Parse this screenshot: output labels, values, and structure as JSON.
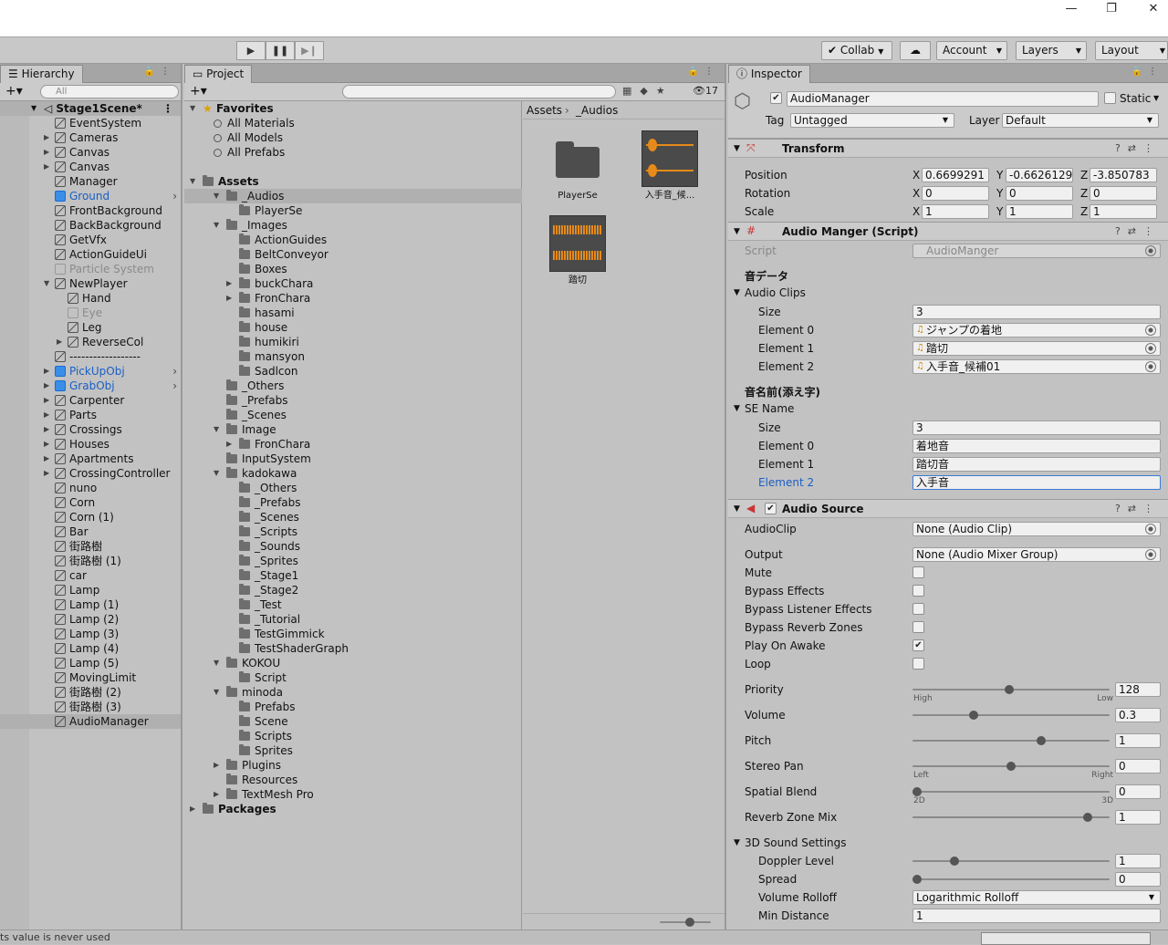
{
  "window_controls": [
    "—",
    "❐",
    "✕"
  ],
  "toolbar": {
    "collab": "Collab",
    "account": "Account",
    "layers": "Layers",
    "layout": "Layout",
    "play": "▶",
    "pause": "❚❚",
    "step": "▶❙"
  },
  "hierarchy": {
    "tab": "Hierarchy",
    "search_placeholder": "All",
    "scene": "Stage1Scene*",
    "items": [
      {
        "label": "EventSystem"
      },
      {
        "label": "Cameras"
      },
      {
        "label": "Canvas"
      },
      {
        "label": "Canvas"
      },
      {
        "label": "Manager"
      },
      {
        "label": "Ground"
      },
      {
        "label": "FrontBackground"
      },
      {
        "label": "BackBackground"
      },
      {
        "label": "GetVfx"
      },
      {
        "label": "ActionGuideUi"
      },
      {
        "label": "Particle System"
      },
      {
        "label": "NewPlayer"
      },
      {
        "label": "Hand"
      },
      {
        "label": "Eye"
      },
      {
        "label": "Leg"
      },
      {
        "label": "ReverseCol"
      },
      {
        "label": "------------------"
      },
      {
        "label": "PickUpObj"
      },
      {
        "label": "GrabObj"
      },
      {
        "label": "Carpenter"
      },
      {
        "label": "Parts"
      },
      {
        "label": "Crossings"
      },
      {
        "label": "Houses"
      },
      {
        "label": "Apartments"
      },
      {
        "label": "CrossingController"
      },
      {
        "label": "nuno"
      },
      {
        "label": "Corn"
      },
      {
        "label": "Corn (1)"
      },
      {
        "label": "Bar"
      },
      {
        "label": "街路樹"
      },
      {
        "label": "街路樹 (1)"
      },
      {
        "label": "car"
      },
      {
        "label": "Lamp"
      },
      {
        "label": "Lamp (1)"
      },
      {
        "label": "Lamp (2)"
      },
      {
        "label": "Lamp (3)"
      },
      {
        "label": "Lamp (4)"
      },
      {
        "label": "Lamp (5)"
      },
      {
        "label": "MovingLimit"
      },
      {
        "label": "街路樹 (2)"
      },
      {
        "label": "街路樹 (3)"
      },
      {
        "label": "AudioManager"
      }
    ]
  },
  "project": {
    "tab": "Project",
    "hidden_count": "17",
    "favorites": "Favorites",
    "fav_items": [
      "All Materials",
      "All Models",
      "All Prefabs"
    ],
    "tree": [
      "Assets",
      "_Audios",
      "PlayerSe",
      "_Images",
      "ActionGuides",
      "BeltConveyor",
      "Boxes",
      "buckChara",
      "FronChara",
      "hasami",
      "house",
      "humikiri",
      "mansyon",
      "Sadlcon",
      "_Others",
      "_Prefabs",
      "_Scenes",
      "Image",
      "FronChara",
      "InputSystem",
      "kadokawa",
      "_Others",
      "_Prefabs",
      "_Scenes",
      "_Scripts",
      "_Sounds",
      "_Sprites",
      "_Stage1",
      "_Stage2",
      "_Test",
      "_Tutorial",
      "TestGimmick",
      "TestShaderGraph",
      "KOKOU",
      "Script",
      "minoda",
      "Prefabs",
      "Scene",
      "Scripts",
      "Sprites",
      "Plugins",
      "Resources",
      "TextMesh Pro",
      "Packages"
    ],
    "breadcrumb": [
      "Assets",
      "_Audios"
    ],
    "assets": [
      "PlayerSe",
      "入手音_候...",
      "踏切"
    ]
  },
  "inspector": {
    "tab": "Inspector",
    "object_name": "AudioManager",
    "static": "Static",
    "tag_label": "Tag",
    "tag": "Untagged",
    "layer_label": "Layer",
    "layer": "Default",
    "transform": {
      "title": "Transform",
      "position_label": "Position",
      "rotation_label": "Rotation",
      "scale_label": "Scale",
      "position": [
        "0.6699291",
        "-0.6626129",
        "-3.850783"
      ],
      "rotation": [
        "0",
        "0",
        "0"
      ],
      "scale": [
        "1",
        "1",
        "1"
      ],
      "axes": [
        "X",
        "Y",
        "Z"
      ]
    },
    "script_comp": {
      "title": "Audio Manger (Script)",
      "script_label": "Script",
      "script": "AudioManger",
      "header1": "音データ",
      "clips_label": "Audio Clips",
      "size_label": "Size",
      "size": "3",
      "clips": [
        {
          "label": "Element 0",
          "value": "ジャンプの着地"
        },
        {
          "label": "Element 1",
          "value": "踏切"
        },
        {
          "label": "Element 2",
          "value": "入手音_候補01"
        }
      ],
      "header2": "音名前(添え字)",
      "se_label": "SE Name",
      "se_size": "3",
      "se": [
        {
          "label": "Element 0",
          "value": "着地音"
        },
        {
          "label": "Element 1",
          "value": "踏切音"
        },
        {
          "label": "Element 2",
          "value": "入手音"
        }
      ]
    },
    "audio_source": {
      "title": "Audio Source",
      "audioclip_label": "AudioClip",
      "audioclip": "None (Audio Clip)",
      "output_label": "Output",
      "output": "None (Audio Mixer Group)",
      "toggles": [
        {
          "label": "Mute",
          "checked": false
        },
        {
          "label": "Bypass Effects",
          "checked": false
        },
        {
          "label": "Bypass Listener Effects",
          "checked": false
        },
        {
          "label": "Bypass Reverb Zones",
          "checked": false
        },
        {
          "label": "Play On Awake",
          "checked": true
        },
        {
          "label": "Loop",
          "checked": false
        }
      ],
      "sliders": [
        {
          "label": "Priority",
          "value": "128",
          "pos": 0.49,
          "min_label": "High",
          "max_label": "Low"
        },
        {
          "label": "Volume",
          "value": "0.3",
          "pos": 0.3
        },
        {
          "label": "Pitch",
          "value": "1",
          "pos": 0.66
        },
        {
          "label": "Stereo Pan",
          "value": "0",
          "pos": 0.5,
          "min_label": "Left",
          "max_label": "Right"
        },
        {
          "label": "Spatial Blend",
          "value": "0",
          "pos": 0.0,
          "min_label": "2D",
          "max_label": "3D"
        },
        {
          "label": "Reverb Zone Mix",
          "value": "1",
          "pos": 0.91
        }
      ],
      "sound3d_label": "3D Sound Settings",
      "doppler_label": "Doppler Level",
      "doppler": "1",
      "doppler_pos": 0.2,
      "spread_label": "Spread",
      "spread": "0",
      "spread_pos": 0.0,
      "rolloff_label": "Volume Rolloff",
      "rolloff": "Logarithmic Rolloff",
      "mindist_label": "Min Distance",
      "mindist": "1"
    }
  },
  "status": {
    "text": "ts value is never used"
  }
}
